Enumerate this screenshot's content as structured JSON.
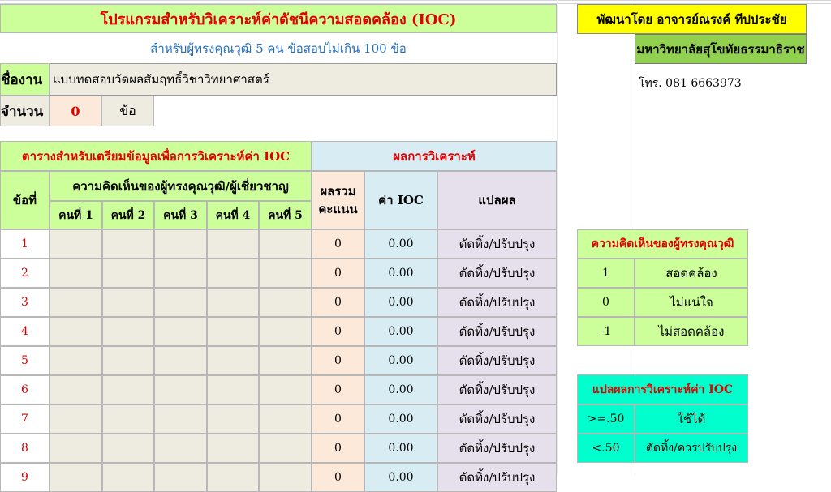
{
  "header": {
    "title": "โปรแกรมสำหรับวิเคราะห์ค่าดัชนีความสอดคล้อง (IOC)",
    "subtitle": "สำหรับผู้ทรงคุณวุฒิ 5 คน ข้อสอบไม่เกิน 100 ข้อ",
    "developer": "พัฒนาโดย อาจารย์ณรงค์ ทีปประชัย",
    "university": "มหาวิทยาลัยสุโขทัยธรรมาธิราช",
    "phone": "โทร. 081 6663973"
  },
  "form": {
    "name_label": "ชื่องาน",
    "name_value": "แบบทดสอบวัดผลสัมฤทธิ์วิชาวิทยาศาสตร์",
    "count_label": "จำนวน",
    "count_value": "0",
    "count_unit": "ข้อ"
  },
  "table": {
    "prep_title": "ตารางสำหรับเตรียมข้อมูลเพื่อการวิเคราะห์ค่า IOC",
    "result_title": "ผลการวิเคราะห์",
    "item_header": "ข้อที่",
    "experts_header": "ความคิดเห็นของผู้ทรงคุณวุฒิ/ผู้เชี่ยวชาญ",
    "expert_cols": [
      "คนที่ 1",
      "คนที่ 2",
      "คนที่ 3",
      "คนที่ 4",
      "คนที่ 5"
    ],
    "total_header_1": "ผลรวม",
    "total_header_2": "คะแนน",
    "ioc_header": "ค่า IOC",
    "interp_header": "แปลผล",
    "rows": [
      {
        "no": "1",
        "total": "0",
        "ioc": "0.00",
        "interp": "ตัดทิ้ง/ปรับปรุง"
      },
      {
        "no": "2",
        "total": "0",
        "ioc": "0.00",
        "interp": "ตัดทิ้ง/ปรับปรุง"
      },
      {
        "no": "3",
        "total": "0",
        "ioc": "0.00",
        "interp": "ตัดทิ้ง/ปรับปรุง"
      },
      {
        "no": "4",
        "total": "0",
        "ioc": "0.00",
        "interp": "ตัดทิ้ง/ปรับปรุง"
      },
      {
        "no": "5",
        "total": "0",
        "ioc": "0.00",
        "interp": "ตัดทิ้ง/ปรับปรุง"
      },
      {
        "no": "6",
        "total": "0",
        "ioc": "0.00",
        "interp": "ตัดทิ้ง/ปรับปรุง"
      },
      {
        "no": "7",
        "total": "0",
        "ioc": "0.00",
        "interp": "ตัดทิ้ง/ปรับปรุง"
      },
      {
        "no": "8",
        "total": "0",
        "ioc": "0.00",
        "interp": "ตัดทิ้ง/ปรับปรุง"
      },
      {
        "no": "9",
        "total": "0",
        "ioc": "0.00",
        "interp": "ตัดทิ้ง/ปรับปรุง"
      }
    ]
  },
  "legend_opinion": {
    "title": "ความคิดเห็นของผู้ทรงคุณวุฒิ",
    "rows": [
      {
        "value": "1",
        "label": "สอดคล้อง"
      },
      {
        "value": "0",
        "label": "ไม่แน่ใจ"
      },
      {
        "value": "-1",
        "label": "ไม่สอดคล้อง"
      }
    ]
  },
  "legend_ioc": {
    "title": "แปลผลการวิเคราะห์ค่า IOC",
    "rows": [
      {
        "value": ">=.50",
        "label": "ใช้ได้"
      },
      {
        "value": "<.50",
        "label": "ตัดทิ้ง/ควรปรับปรุง"
      }
    ]
  },
  "colors": {
    "header_green": "#ccff99",
    "result_cyan": "#d7ecf3",
    "total_peach": "#fde9d9",
    "interp_lavender": "#e6e0ec",
    "developer_yellow": "#ffff00",
    "university_green": "#92d050",
    "ioc_legend_aqua": "#00ffcc",
    "accent_red": "#e00000",
    "subtitle_blue": "#1f6fbf"
  }
}
